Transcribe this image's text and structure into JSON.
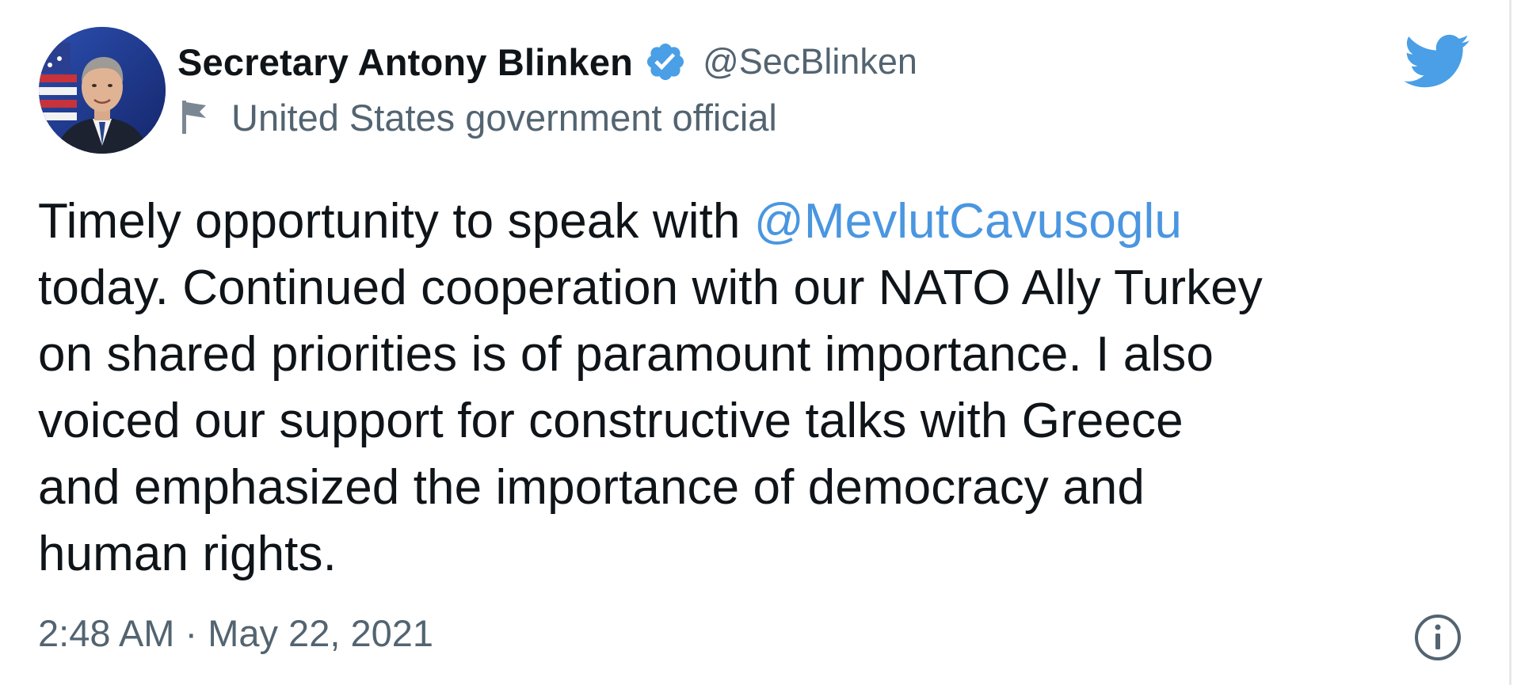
{
  "author": {
    "display_name": "Secretary Antony Blinken",
    "handle": "@SecBlinken",
    "label": "United States government official",
    "verified_icon": "verified-badge-icon",
    "label_icon": "flag-icon"
  },
  "tweet": {
    "lines": [
      {
        "before": "Timely opportunity to speak with ",
        "mention": "@MevlutCavusoglu"
      },
      {
        "text": "today. Continued cooperation with our NATO Ally Turkey"
      },
      {
        "text": "on shared priorities is of paramount importance. I also"
      },
      {
        "text": "voiced our support for constructive talks with Greece"
      },
      {
        "text": "and emphasized the importance of democracy and"
      },
      {
        "text": "human rights."
      }
    ],
    "timestamp": "2:48 AM · May 22, 2021"
  },
  "icons": {
    "logo": "twitter-bird-icon",
    "info": "info-icon"
  },
  "colors": {
    "text": "#0f1419",
    "secondary": "#536471",
    "mention": "#4a96e0",
    "brand": "#4a9fe6"
  }
}
